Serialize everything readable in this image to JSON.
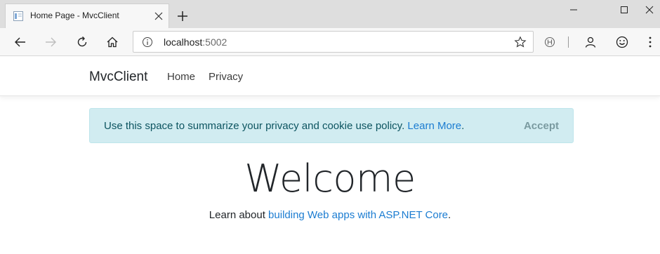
{
  "browser": {
    "tab_title": "Home Page - MvcClient",
    "address_host": "localhost",
    "address_port": ":5002"
  },
  "navbar": {
    "brand": "MvcClient",
    "links": [
      "Home",
      "Privacy"
    ]
  },
  "cookie_banner": {
    "text": "Use this space to summarize your privacy and cookie use policy. ",
    "link": "Learn More",
    "after_link": ".",
    "accept": "Accept"
  },
  "main": {
    "heading": "Welcome",
    "learn_prefix": "Learn about ",
    "learn_link": "building Web apps with ASP.NET Core",
    "learn_suffix": "."
  },
  "colors": {
    "link": "#1b7cd1",
    "alert_bg": "#d1ecf1",
    "alert_text": "#0c5460"
  },
  "icons": [
    "page-favicon-icon",
    "close-icon",
    "plus-icon",
    "minimize-icon",
    "maximize-icon",
    "back-arrow-icon",
    "forward-arrow-icon",
    "refresh-icon",
    "home-icon",
    "info-icon",
    "star-icon",
    "hub-icon",
    "profile-icon",
    "smiley-icon"
  ]
}
